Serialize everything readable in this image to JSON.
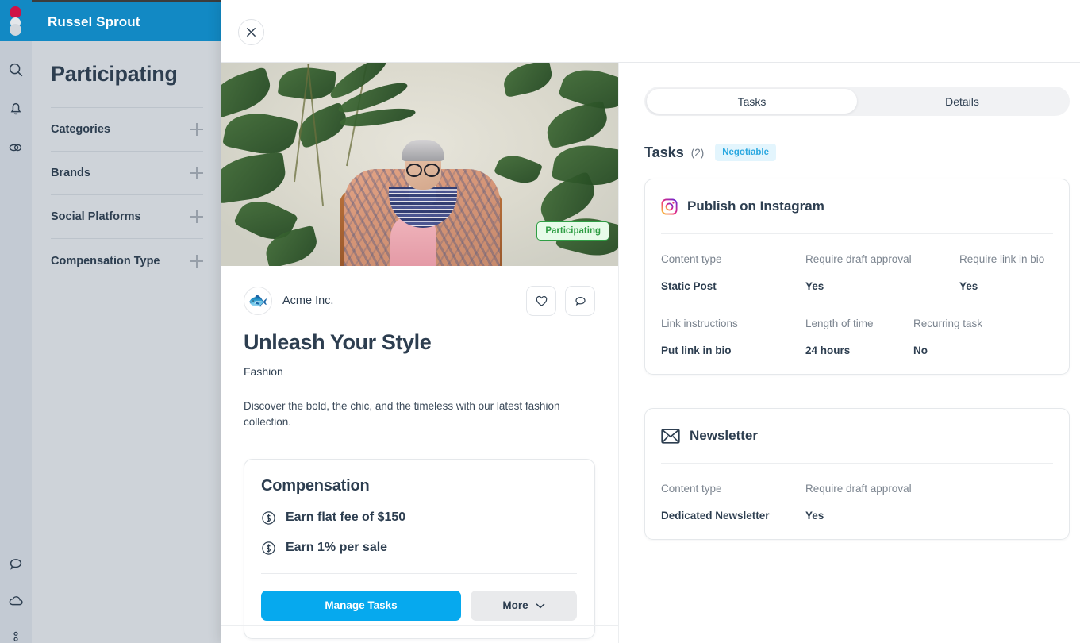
{
  "app": {
    "title": "Russel Sprout",
    "brand_color": "#1289c4",
    "accent_color": "#06a9ee"
  },
  "rail": {
    "logo_name": "russel-sprout-logo",
    "items": [
      {
        "icon": "search-icon",
        "label": "Search"
      },
      {
        "icon": "bell-icon",
        "label": "Notifications"
      },
      {
        "icon": "links-icon",
        "label": "Links"
      },
      {
        "icon": "chat-icon",
        "label": "Messages"
      },
      {
        "icon": "cloud-icon",
        "label": "Cloud"
      },
      {
        "icon": "more-dots-icon",
        "label": "More"
      }
    ]
  },
  "sidebar": {
    "title": "Participating",
    "filters": [
      {
        "label": "Categories",
        "expand_icon": "plus-icon"
      },
      {
        "label": "Brands",
        "expand_icon": "plus-icon"
      },
      {
        "label": "Social Platforms",
        "expand_icon": "plus-icon"
      },
      {
        "label": "Compensation Type",
        "expand_icon": "plus-icon"
      }
    ]
  },
  "modal": {
    "close_icon": "close-icon",
    "offer": {
      "hero_badge": "Participating",
      "hero_badge_color": "#2f9e44",
      "avatar_icon": "fish-emoji",
      "avatar_glyph": "🐟",
      "brand_name": "Acme Inc.",
      "like_icon": "heart-icon",
      "comment_icon": "comment-icon",
      "title": "Unleash Your Style",
      "category": "Fashion",
      "description": "Discover the bold, the chic, and the timeless with our latest fashion collection."
    },
    "compensation": {
      "title": "Compensation",
      "items": [
        {
          "icon": "dollar-coin-icon",
          "text": "Earn flat fee of $150"
        },
        {
          "icon": "dollar-coin-icon",
          "text": "Earn 1% per sale"
        }
      ],
      "primary_button": "Manage Tasks",
      "secondary_button": "More",
      "secondary_icon": "chevron-down-icon"
    },
    "tabs": [
      {
        "label": "Tasks",
        "active": true
      },
      {
        "label": "Details",
        "active": false
      }
    ],
    "tasks_header": {
      "title": "Tasks",
      "count": "(2)",
      "badge": "Negotiable",
      "badge_color": "#2aa8e0"
    },
    "tasks": [
      {
        "icon": "instagram-icon",
        "name": "Publish on Instagram",
        "rows": [
          [
            {
              "label": "Content type",
              "value": "Static Post"
            },
            {
              "label": "Require draft approval",
              "value": "Yes"
            },
            {
              "label": "Require link in bio",
              "value": "Yes"
            }
          ],
          [
            {
              "label": "Link instructions",
              "value": "Put link in bio"
            },
            {
              "label": "Length of time",
              "value": "24 hours"
            },
            {
              "label": "Recurring task",
              "value": "No"
            }
          ]
        ]
      },
      {
        "icon": "envelope-icon",
        "name": "Newsletter",
        "rows": [
          [
            {
              "label": "Content type",
              "value": "Dedicated Newsletter"
            },
            {
              "label": "Require draft approval",
              "value": "Yes"
            }
          ]
        ]
      }
    ]
  }
}
